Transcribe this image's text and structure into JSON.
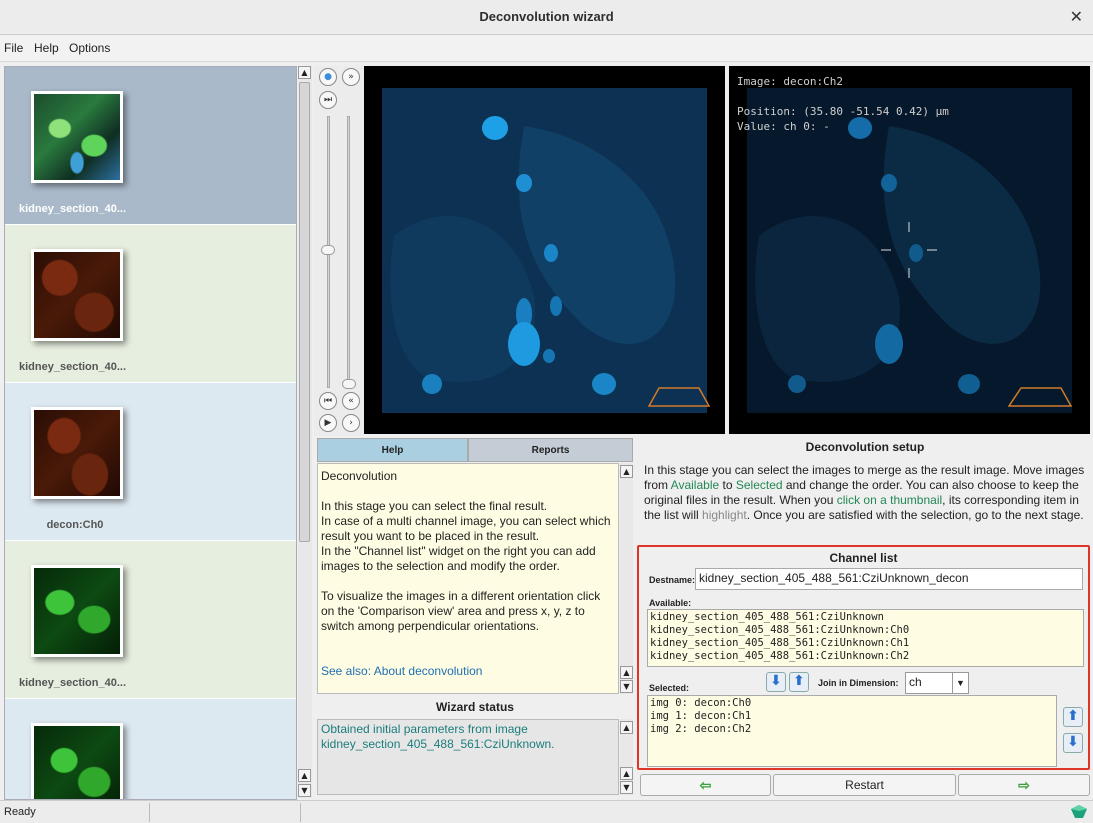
{
  "window": {
    "title": "Deconvolution wizard"
  },
  "menu": {
    "file": "File",
    "help": "Help",
    "options": "Options"
  },
  "thumbnails": [
    {
      "label": "kidney_section_40...",
      "selected": true
    },
    {
      "label": "kidney_section_40..."
    },
    {
      "label": "decon:Ch0"
    },
    {
      "label": "kidney_section_40..."
    },
    {
      "label": ""
    }
  ],
  "viewer_right": {
    "image_line": "Image: decon:Ch2",
    "position_line": "Position: (35.80 -51.54 0.42) µm",
    "value_line": "Value: ch 0: -"
  },
  "tabs": {
    "help": "Help",
    "reports": "Reports"
  },
  "help": {
    "title": "Deconvolution",
    "para1": "In this stage you can select the final result.",
    "para2": "In case of a multi channel image, you can select which result you want to be placed in the result.",
    "para3": "In the \"Channel list\" widget on the right you can add images to the selection and modify the order.",
    "para4": "To visualize the images in a different orientation click on the 'Comparison view' area and press x, y, z to switch among perpendicular orientations.",
    "link": "See also: About deconvolution"
  },
  "wizard_status": {
    "heading": "Wizard status",
    "text": "Obtained initial parameters from image kidney_section_405_488_561:CziUnknown."
  },
  "setup": {
    "heading": "Deconvolution setup",
    "t1": "In this stage you can select the images to merge as the result image. Move images from ",
    "available_word": "Available",
    "t2": " to ",
    "selected_word": "Selected",
    "t3": " and change the order. You can also choose to keep the original files in the result. When you ",
    "click_thumb": "click on a thumbnail",
    "t4": ", its corresponding item in the list will ",
    "highlight": "highlight",
    "t5": ". Once you are satisfied with the selection, go to the next stage."
  },
  "channel_list": {
    "heading": "Channel list",
    "destname_label": "Destname:",
    "destname_value": "kidney_section_405_488_561:CziUnknown_decon",
    "available_label": "Available:",
    "available": [
      "kidney_section_405_488_561:CziUnknown",
      "kidney_section_405_488_561:CziUnknown:Ch0",
      "kidney_section_405_488_561:CziUnknown:Ch1",
      "kidney_section_405_488_561:CziUnknown:Ch2"
    ],
    "selected_label": "Selected:",
    "join_label": "Join in Dimension:",
    "join_value": "ch",
    "selected": [
      "img 0: decon:Ch0",
      "img 1: decon:Ch1",
      "img 2: decon:Ch2"
    ]
  },
  "buttons": {
    "back": "⇦",
    "restart": "Restart",
    "next": "⇨"
  },
  "status": {
    "text": "Ready"
  },
  "colors": {
    "highlight_border": "#e0342a",
    "help_bg": "#fefde3",
    "selected_thumb_bg": "#a9b9c9"
  }
}
